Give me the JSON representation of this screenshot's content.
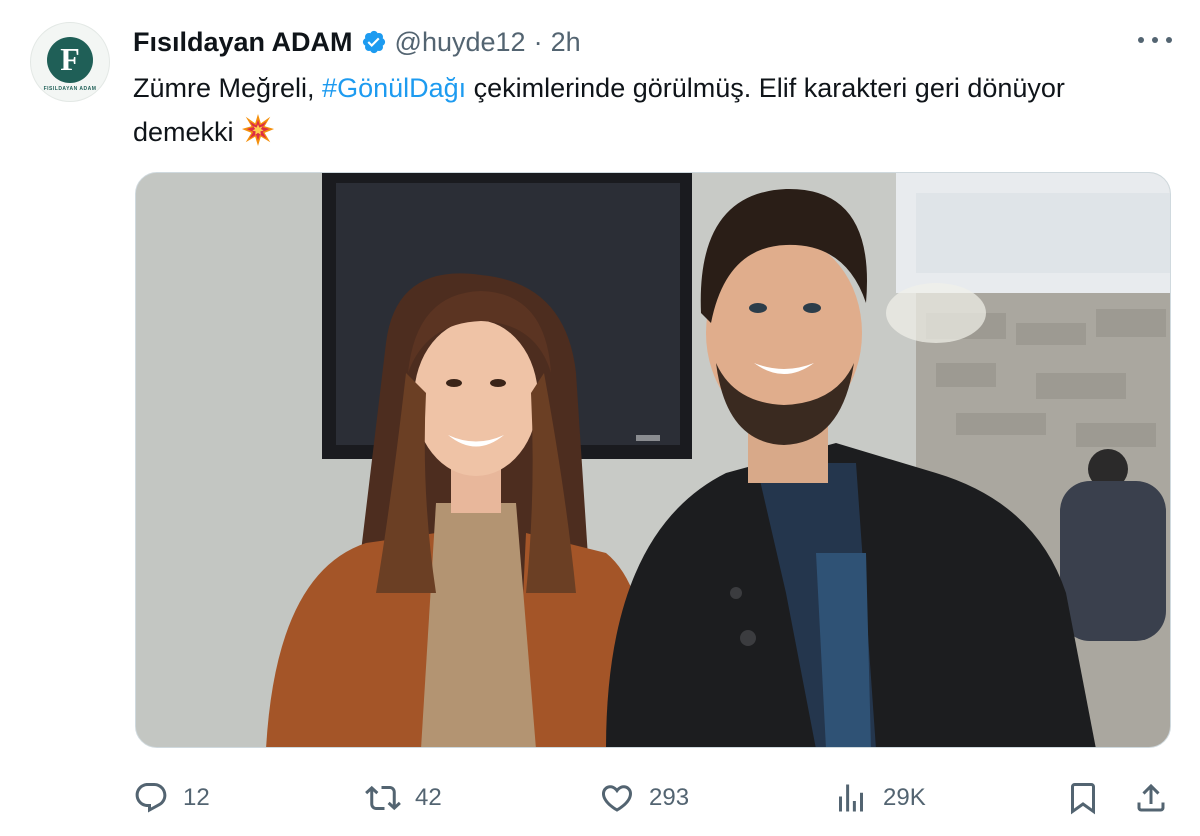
{
  "author": {
    "name": "Fısıldayan ADAM",
    "handle": "@huyde12",
    "separator": "·",
    "time": "2h",
    "avatar_letter": "F",
    "avatar_brand": "FISILDAYAN ADAM",
    "verified": true
  },
  "tweet": {
    "text_before": "Zümre Meğreli, ",
    "hashtag": "#GönülDağı",
    "text_after": " çekimlerinde görülmüş. Elif karakteri geri dönüyor demekki ",
    "emoji": "collision-emoji"
  },
  "actions": {
    "replies": "12",
    "retweets": "42",
    "likes": "293",
    "views": "29K"
  },
  "icons": {
    "reply": "reply-icon",
    "retweet": "retweet-icon",
    "like": "heart-icon",
    "views": "views-icon",
    "bookmark": "bookmark-icon",
    "share": "share-icon",
    "more": "more-icon",
    "verified": "verified-badge-icon"
  },
  "colors": {
    "text": "#0f1419",
    "secondary": "#536471",
    "link": "#1d9bf0",
    "verified": "#1d9bf0",
    "avatar": "#1f5f57"
  }
}
